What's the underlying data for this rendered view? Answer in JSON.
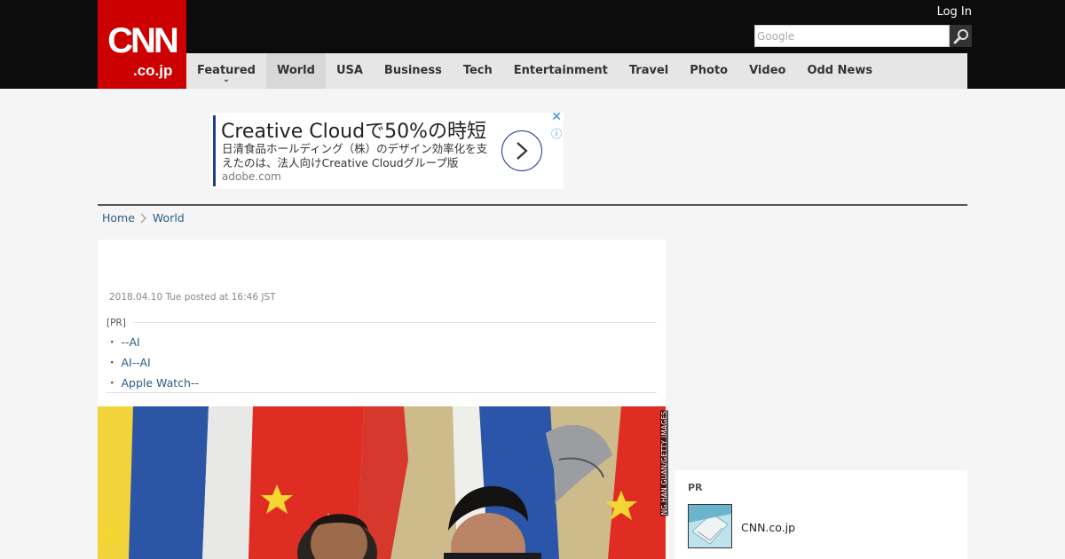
{
  "header": {
    "logo_main": "CNN",
    "logo_sub": ".co.jp",
    "login": "Log In",
    "search_placeholder": "Google"
  },
  "nav": {
    "items": [
      "Featured",
      "World",
      "USA",
      "Business",
      "Tech",
      "Entertainment",
      "Travel",
      "Photo",
      "Video",
      "Odd News"
    ],
    "active": "World"
  },
  "ad": {
    "title": "Creative Cloudで50%の時短",
    "body": "日清食品ホールディング（株）のデザイン効率化を支えたのは、法人向けCreative Cloudグループ版",
    "domain": "adobe.com",
    "close": "✕",
    "info": "ⓘ"
  },
  "breadcrumb": {
    "home": "Home",
    "section": "World"
  },
  "article": {
    "date": "2018.04.10 Tue posted at 16:46 JST",
    "pr_label": "[PR]",
    "pr_links": [
      "--AI",
      "AI--AI",
      "Apple Watch--"
    ],
    "photo_credit": "NG HAN GUAN/GETTY IMAGES"
  },
  "sidebar": {
    "pr_label": "PR",
    "item_title": "CNN.co.jp"
  },
  "colors": {
    "brand_red": "#cc0000",
    "link_blue": "#2a5b84",
    "ad_accent": "#1f3a93"
  }
}
